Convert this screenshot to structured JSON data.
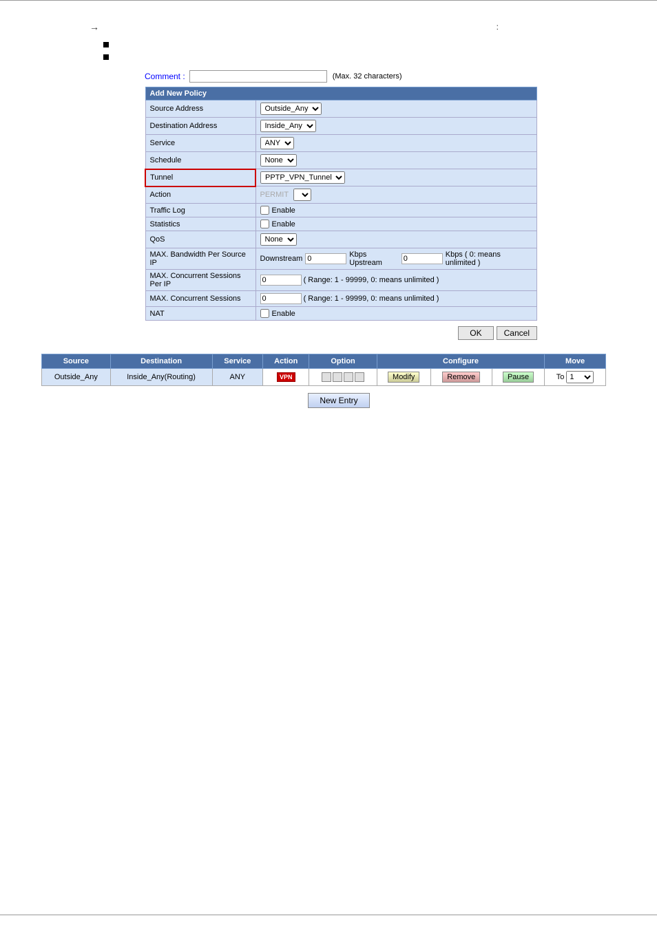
{
  "page": {
    "arrow_text": "→",
    "colon": ":",
    "bullet1": "",
    "bullet2": "",
    "comment_label": "Comment :",
    "comment_placeholder": "",
    "comment_hint": "(Max. 32 characters)",
    "policy_form": {
      "header": "Add New Policy",
      "fields": [
        {
          "label": "Source Address",
          "type": "select",
          "value": "Outside_Any"
        },
        {
          "label": "Destination Address",
          "type": "select",
          "value": "Inside_Any"
        },
        {
          "label": "Service",
          "type": "select",
          "value": "ANY"
        },
        {
          "label": "Schedule",
          "type": "select",
          "value": "None"
        },
        {
          "label": "Tunnel",
          "type": "select",
          "value": "PPTP_VPN_Tunnel",
          "highlight": true
        },
        {
          "label": "Action",
          "type": "text",
          "value": "PERMIT"
        },
        {
          "label": "Traffic Log",
          "type": "checkbox",
          "value": "Enable"
        },
        {
          "label": "Statistics",
          "type": "checkbox",
          "value": "Enable"
        },
        {
          "label": "QoS",
          "type": "select",
          "value": "None"
        },
        {
          "label": "MAX. Bandwidth Per Source IP",
          "type": "bandwidth",
          "downstream": "0",
          "upstream": "0",
          "hint": "Kbps ( 0: means unlimited )"
        },
        {
          "label": "MAX. Concurrent Sessions Per IP",
          "type": "input_hint",
          "value": "0",
          "hint": "( Range: 1 - 99999, 0: means unlimited )"
        },
        {
          "label": "MAX. Concurrent Sessions",
          "type": "input_hint",
          "value": "0",
          "hint": "( Range: 1 - 99999, 0: means unlimited )"
        },
        {
          "label": "NAT",
          "type": "checkbox",
          "value": "Enable"
        }
      ]
    },
    "buttons": {
      "ok": "OK",
      "cancel": "Cancel"
    },
    "policy_list": {
      "columns": [
        "Source",
        "Destination",
        "Service",
        "Action",
        "Option",
        "Configure",
        "Move"
      ],
      "configure_label": "Configure",
      "rows": [
        {
          "source": "Outside_Any",
          "destination": "Inside_Any(Routing)",
          "service": "ANY",
          "action": "VPN",
          "options": [
            "",
            "",
            "",
            ""
          ],
          "configure": [
            "Modify",
            "Remove",
            "Pause"
          ],
          "move_to": "To",
          "move_val": "1"
        }
      ]
    },
    "new_entry_button": "New Entry"
  }
}
